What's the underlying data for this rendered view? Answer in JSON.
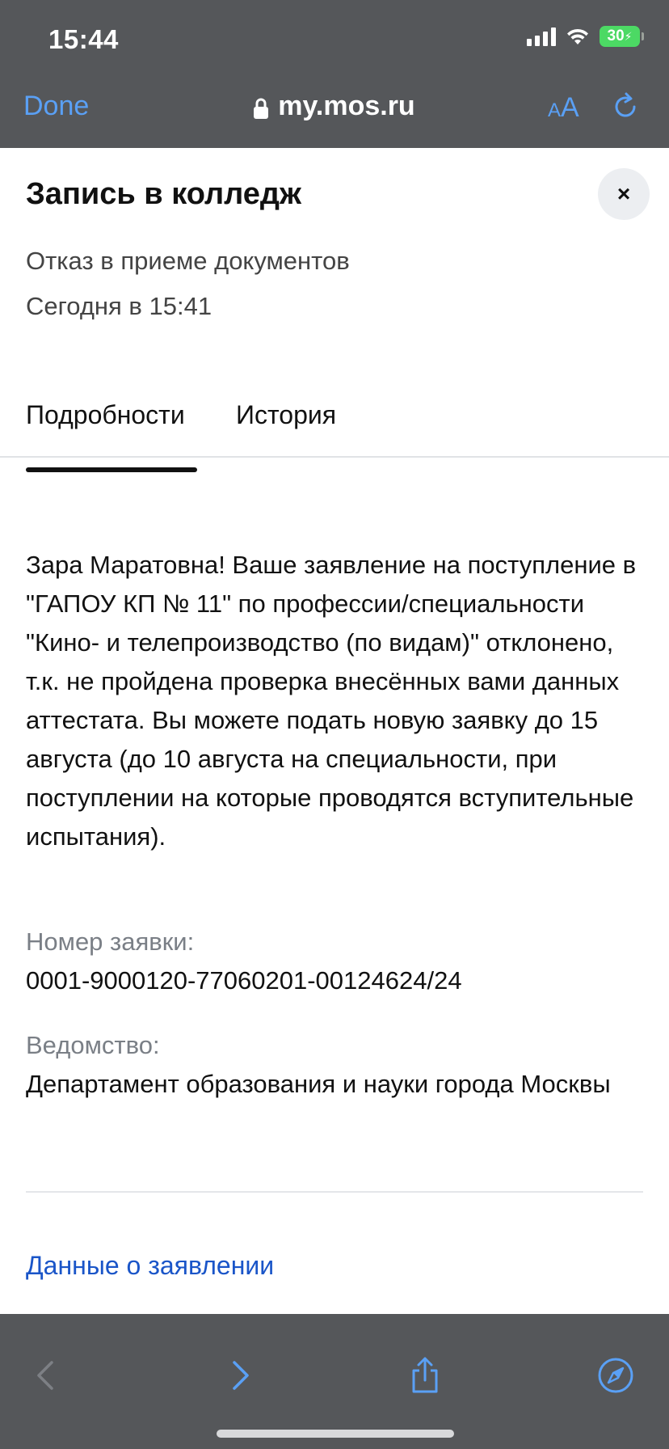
{
  "status_bar": {
    "time": "15:44",
    "battery": "30"
  },
  "browser": {
    "done_label": "Done",
    "url": "my.mos.ru",
    "aa_small": "A",
    "aa_big": "A",
    "accent_color": "#5aa0f5",
    "chrome_color": "#55575a"
  },
  "page": {
    "title": "Запись в колледж",
    "close_label": "×",
    "status": "Отказ в приеме документов",
    "date": "Сегодня в 15:41",
    "tabs": [
      {
        "label": "Подробности",
        "active": true
      },
      {
        "label": "История",
        "active": false
      }
    ],
    "message": "Зара Маратовна! Ваше заявление на поступление в \"ГАПОУ КП № 11\" по профессии/специальности \"Кино- и телепроизводство (по видам)\" отклонено, т.к. не пройдена проверка внесённых вами данных аттестата. Вы можете подать новую заявку до 15 августа (до 10 августа на специальности, при поступлении на которые проводятся вступительные испытания).",
    "application_number_label": "Номер заявки:",
    "application_number": "0001-9000120-77060201-00124624/24",
    "department_label": "Ведомство:",
    "department": "Департамент образования и науки города Москвы",
    "application_data_link": "Данные о заявлении",
    "link_color": "#1a55c8"
  },
  "toolbar": {
    "icons": [
      "back-icon",
      "forward-icon",
      "share-icon",
      "compass-icon"
    ]
  }
}
